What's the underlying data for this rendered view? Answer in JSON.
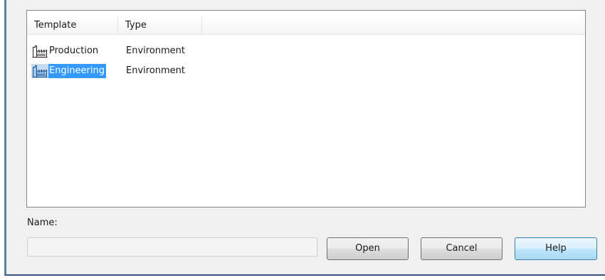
{
  "listview": {
    "columns": [
      {
        "label": "Template"
      },
      {
        "label": "Type"
      }
    ],
    "rows": [
      {
        "template": "Production",
        "type": "Environment",
        "icon": "factory-icon",
        "selected": false
      },
      {
        "template": "Engineering",
        "type": "Environment",
        "icon": "factory-icon",
        "selected": true
      }
    ]
  },
  "name": {
    "label": "Name:",
    "value": ""
  },
  "buttons": {
    "open": "Open",
    "cancel": "Cancel",
    "help": "Help"
  },
  "colors": {
    "selection": "#3399ff",
    "frame": "#34547c",
    "dialog_bg": "#f0f0f0"
  }
}
